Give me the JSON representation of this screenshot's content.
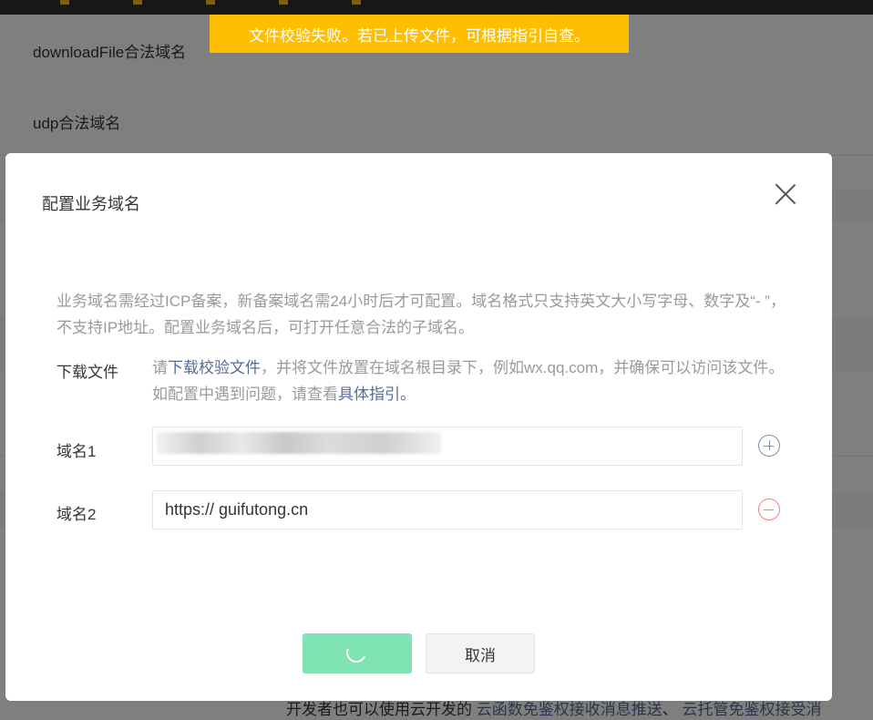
{
  "background": {
    "field_download": "downloadFile合法域名",
    "field_udp": "udp合法域名",
    "bottom_text": "开发者也可以使用云开发的",
    "bottom_link1": "云函数免鉴权接收消息推送",
    "bottom_sep": "、",
    "bottom_link2": "云托管免鉴权接受消"
  },
  "toast": {
    "message": "文件校验失败。若已上传文件，可根据指引自查。"
  },
  "dialog": {
    "title": "配置业务域名",
    "description": "业务域名需经过ICP备案，新备案域名需24小时后才可配置。域名格式只支持英文大小写字母、数字及“- ”，不支持IP地址。配置业务域名后，可打开任意合法的子域名。",
    "download": {
      "label": "下载文件",
      "text_before": "请",
      "link_download": "下载校验文件",
      "text_middle": "，并将文件放置在域名根目录下，例如wx.qq.com，并确保可以访问该文件。如配置中遇到问题，请查看",
      "link_guide": "具体指引",
      "text_after": "。"
    },
    "domain1": {
      "label": "域名1",
      "value": ""
    },
    "domain2": {
      "label": "域名2",
      "value": "https:// guifutong.cn"
    },
    "icons": {
      "add": "plus-circle-icon",
      "remove": "minus-circle-icon",
      "close": "close-icon",
      "loading": "spinner-icon"
    },
    "buttons": {
      "cancel": "取消"
    },
    "colors": {
      "confirm": "#7fe3b3",
      "toast": "#ffbe00",
      "link": "#576b95",
      "remove": "#f07f7f"
    }
  }
}
